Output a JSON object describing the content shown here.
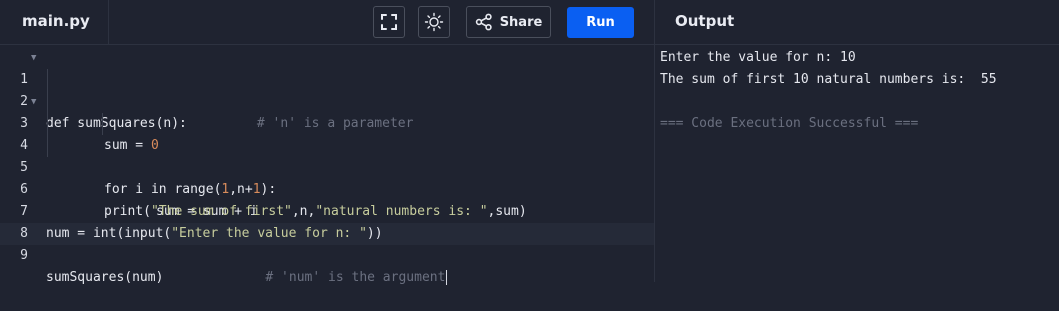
{
  "header": {
    "file_tab": "main.py",
    "share_label": "Share",
    "run_label": "Run",
    "output_tab": "Output"
  },
  "icons": [
    "fullscreen-icon",
    "sun-icon",
    "share-icon"
  ],
  "colors": {
    "background": "#1f2330",
    "run_button": "#0a5ff2",
    "number": "#d98c5c",
    "string": "#c7cd9d",
    "comment": "#6b7080"
  },
  "editor": {
    "lines": [
      {
        "n": "1",
        "segs": [
          "def sumSquares(n):",
          "# 'n' is a parameter"
        ]
      },
      {
        "n": "2",
        "segs": [
          "sum = ",
          "0"
        ]
      },
      {
        "n": "3",
        "segs": [
          "for i in range(",
          "1",
          ",n+",
          "1",
          "):"
        ]
      },
      {
        "n": "4",
        "segs": [
          "sum = sum + i"
        ]
      },
      {
        "n": "5",
        "segs": [
          "print(",
          "\"The sum of first\"",
          ",n,",
          "\"natural numbers is: \"",
          ",sum)"
        ]
      },
      {
        "n": "6",
        "segs": []
      },
      {
        "n": "7",
        "segs": [
          "num = int(input(",
          "\"Enter the value for n: \"",
          "))"
        ]
      },
      {
        "n": "8",
        "segs": []
      },
      {
        "n": "9",
        "segs": [
          "sumSquares(num)",
          "# 'num' is the argument"
        ]
      }
    ]
  },
  "output": {
    "lines": [
      "Enter the value for n: 10",
      "The sum of first 10 natural numbers is:  55",
      "",
      "=== Code Execution Successful ==="
    ]
  }
}
